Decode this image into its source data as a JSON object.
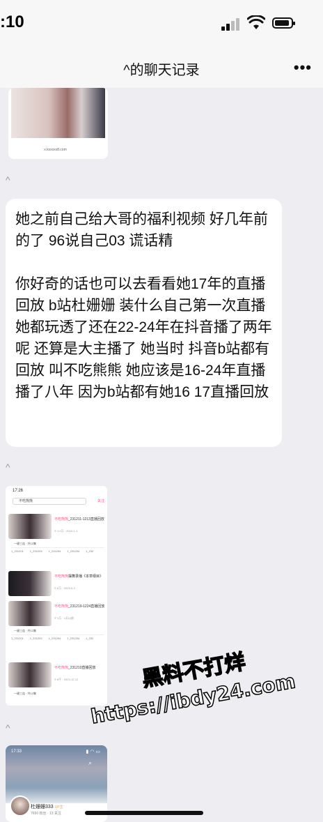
{
  "status_bar": {
    "time": ":10"
  },
  "nav": {
    "title": "^的聊天记录",
    "more": "•••"
  },
  "image1": {
    "caption": "x.kxxxxx8.com"
  },
  "separator": "^",
  "message": {
    "paragraphs": [
      "她之前自己给大哥的福利视频 好几年前的了 96说自己03 谎话精",
      "你好奇的话也可以去看看她17年的直播回放 b站杜姗姗 装什么自己第一次直播 她都玩透了还在22-24年在抖音播了两年呢 还算是大主播了 她当时 抖音b站都有回放 叫不吃熊熊 她应该是16-24年直播 播了八年 因为b站都有她16 17直播回放"
    ]
  },
  "screenshot": {
    "time": "17:26",
    "search": "不吃熊熊",
    "follow": "关注",
    "rows": [
      {
        "title_pink": "不吃熊熊",
        "title": "_231211-1213直播回放",
        "meta": "© 1.0万 · 2024-1-1"
      },
      {
        "title_pink": "不吃熊熊",
        "title": "摆舞录播《本草纲目》",
        "meta": "© 6万 · 2023-5-2"
      },
      {
        "title_pink": "不吃熊熊",
        "title": "_231219-1224直播回放",
        "meta": "© 1万 · 1天以前"
      },
      {
        "title_pink": "不吃熊熊",
        "title": "_231210直播回放",
        "meta": "© 8千 · 2023-12-12"
      }
    ],
    "row_meta": "一键三连 · 共12集",
    "grid": [
      "1_231201",
      "1_231203",
      "1_231204",
      "1_231204",
      "1_232"
    ]
  },
  "last_card": {
    "time": "17:33",
    "name": "杜姗姗333",
    "badge": "UP主",
    "stats": "7650 粉丝 · 13 关注"
  },
  "watermark": {
    "line1": "黑料不打烊",
    "line2": "https://ibdy24.com"
  }
}
